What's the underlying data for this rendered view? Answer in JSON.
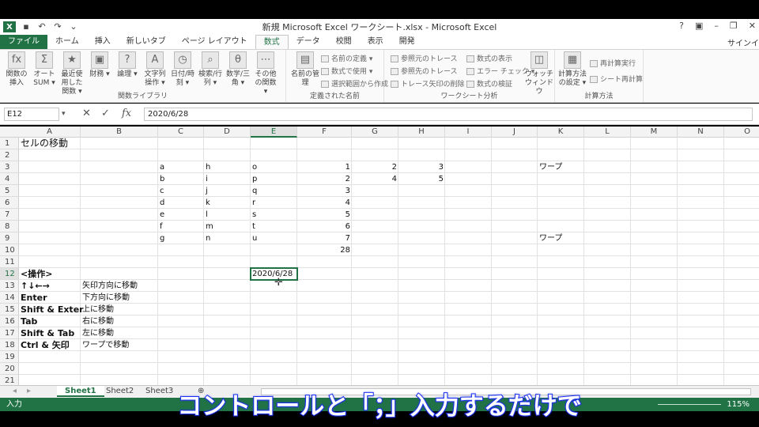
{
  "window": {
    "title": "新規 Microsoft Excel ワークシート.xlsx - Microsoft Excel",
    "help": "?",
    "signin": "サインイ"
  },
  "tabs": [
    "ファイル",
    "ホーム",
    "挿入",
    "新しいタブ",
    "ページ レイアウト",
    "数式",
    "データ",
    "校閲",
    "表示",
    "開発"
  ],
  "ribbon": {
    "lib_buttons": [
      "関数の挿入",
      "オート SUM ▾",
      "最近使用した関数 ▾",
      "財務 ▾",
      "論理 ▾",
      "文字列操作 ▾",
      "日付/時刻 ▾",
      "検索/行列 ▾",
      "数学/三角 ▾",
      "その他の関数 ▾"
    ],
    "lib_label": "関数ライブラリ",
    "names_big": "名前の管理",
    "names_small": [
      "名前の定義 ▾",
      "数式で使用 ▾",
      "選択範囲から作成"
    ],
    "names_label": "定義された名前",
    "audit_small": [
      "参照元のトレース",
      "参照先のトレース",
      "トレース矢印の削除 ▾",
      "数式の表示",
      "エラー チェック ▾",
      "数式の検証"
    ],
    "watch": "ウォッチ ウィンドウ",
    "audit_label": "ワークシート分析",
    "calc_big": "計算方法の設定 ▾",
    "calc_small": [
      "再計算実行",
      "シート再計算"
    ],
    "calc_label": "計算方法"
  },
  "formula_bar": {
    "namebox": "E12",
    "content": "2020/6/28"
  },
  "columns": [
    "A",
    "B",
    "C",
    "D",
    "E",
    "F",
    "G",
    "H",
    "I",
    "J",
    "K",
    "L",
    "M",
    "N",
    "O"
  ],
  "cells": {
    "A1": "セルの移動",
    "C3": "a",
    "D3": "h",
    "E3": "o",
    "F3": "1",
    "G3": "2",
    "H3": "3",
    "K3": "ワープ",
    "C4": "b",
    "D4": "i",
    "E4": "p",
    "F4": "2",
    "G4": "4",
    "H4": "5",
    "C5": "c",
    "D5": "j",
    "E5": "q",
    "F5": "3",
    "C6": "d",
    "D6": "k",
    "E6": "r",
    "F6": "4",
    "C7": "e",
    "D7": "l",
    "E7": "s",
    "F7": "5",
    "C8": "f",
    "D8": "m",
    "E8": "t",
    "F8": "6",
    "C9": "g",
    "D9": "n",
    "E9": "u",
    "F9": "7",
    "K9": "ワープ",
    "F10": "28",
    "A12": "<操作>",
    "E12": "2020/6/28",
    "A13": "↑↓←→",
    "B13": "矢印方向に移動",
    "A14": "Enter",
    "B14": "下方向に移動",
    "A15": "Shift & Exter",
    "B15": "上に移動",
    "A16": "Tab",
    "B16": "右に移動",
    "A17": "Shift & Tab",
    "B17": "左に移動",
    "A18": "Ctrl & 矢印",
    "B18": "ワープで移動"
  },
  "sheets": [
    "Sheet1",
    "Sheet2",
    "Sheet3"
  ],
  "status": {
    "mode": "入力",
    "zoom": "115%"
  },
  "subtitle": "コントロールと「；」入力するだけで"
}
